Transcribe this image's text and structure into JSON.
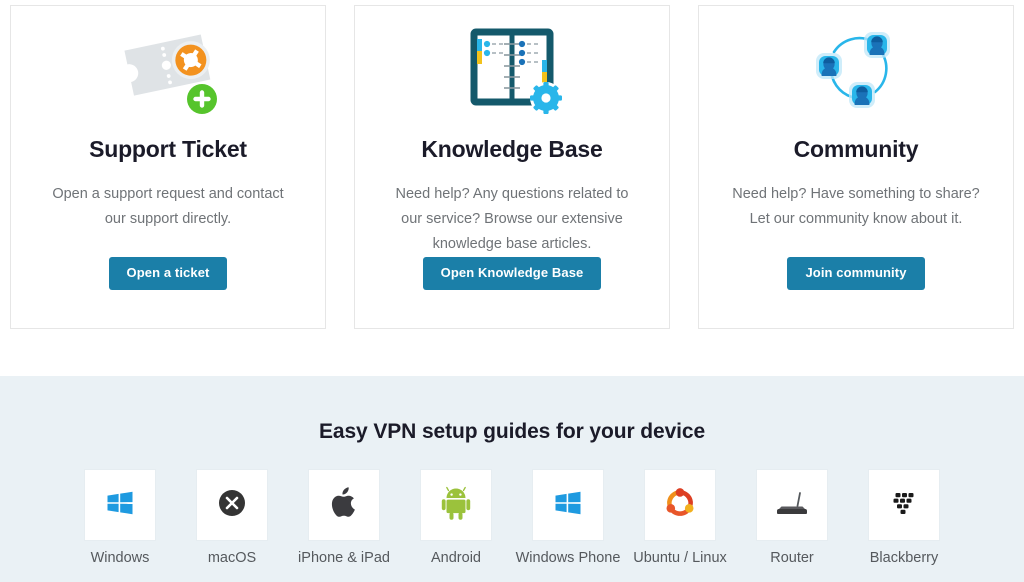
{
  "cards": [
    {
      "icon": "support-ticket-icon",
      "title": "Support Ticket",
      "description": "Open a support request and contact our support directly.",
      "button_label": "Open a ticket"
    },
    {
      "icon": "knowledge-base-book-icon",
      "title": "Knowledge Base",
      "description": "Need help? Any questions related to our service? Browse our extensive knowledge base articles.",
      "button_label": "Open Knowledge Base"
    },
    {
      "icon": "community-people-icon",
      "title": "Community",
      "description": "Need help? Have something to share? Let our community know about it.",
      "button_label": "Join community"
    }
  ],
  "devices_section": {
    "title": "Easy VPN setup guides for your device",
    "devices": [
      {
        "icon": "windows-logo-icon",
        "label": "Windows"
      },
      {
        "icon": "macos-x-logo-icon",
        "label": "macOS"
      },
      {
        "icon": "apple-logo-icon",
        "label": "iPhone & iPad"
      },
      {
        "icon": "android-robot-icon",
        "label": "Android"
      },
      {
        "icon": "windows-phone-logo-icon",
        "label": "Windows Phone"
      },
      {
        "icon": "ubuntu-logo-icon",
        "label": "Ubuntu / Linux"
      },
      {
        "icon": "router-icon",
        "label": "Router"
      },
      {
        "icon": "blackberry-logo-icon",
        "label": "Blackberry"
      }
    ]
  },
  "colors": {
    "button_blue": "#1b7fa8",
    "band_background": "#eaf1f5",
    "card_border": "#e6e6e6",
    "title_text": "#1b1b29",
    "body_text": "#6f7377",
    "windows_blue": "#1e9ae0",
    "android_green": "#9bc23c",
    "ubuntu_orange": "#e8562a",
    "ticket_orange": "#f3921f",
    "plus_green": "#56c42c",
    "book_teal": "#14596b",
    "accent_cyan": "#29b6ea"
  }
}
